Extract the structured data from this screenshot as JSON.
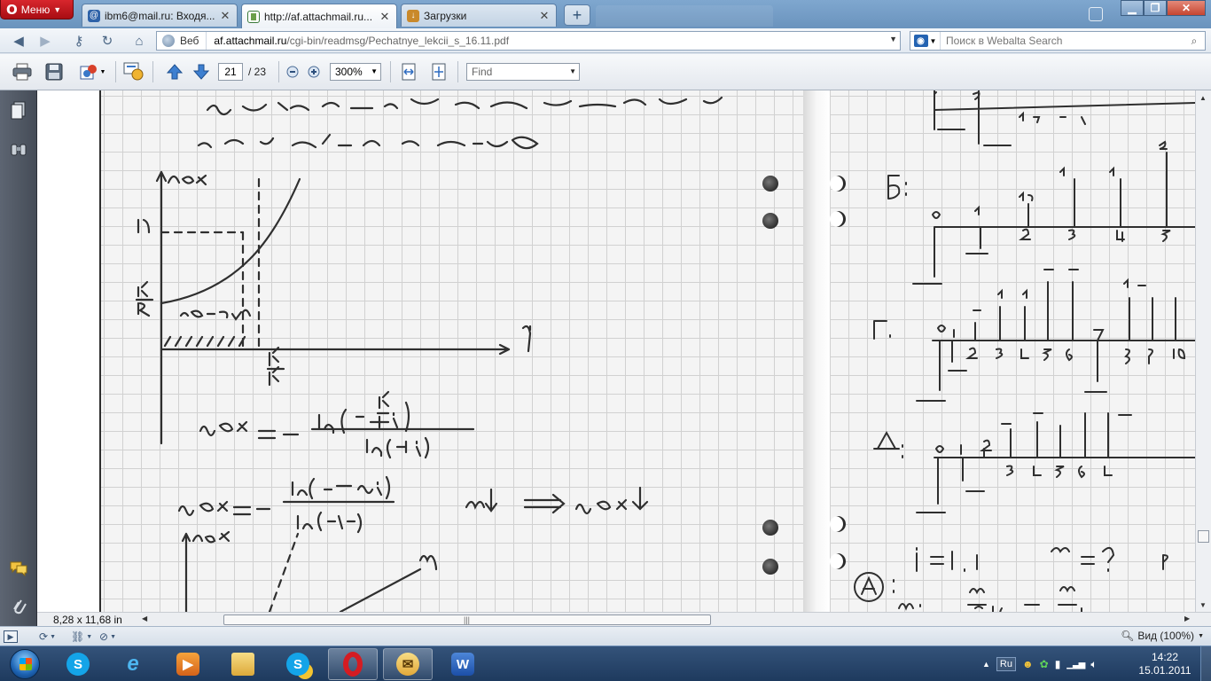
{
  "browser": {
    "menu_label": "Меню",
    "tabs": [
      {
        "title": "ibm6@mail.ru: Входя...",
        "active": false
      },
      {
        "title": "http://af.attachmail.ru...",
        "active": true
      },
      {
        "title": "Загрузки",
        "active": false
      }
    ],
    "new_tab_label": "+",
    "address": {
      "web_label": "Веб",
      "url_host": "af.attachmail.ru",
      "url_path": "/cgi-bin/readmsg/Pechatnye_lekcii_s_16.11.pdf"
    },
    "search": {
      "placeholder": "Поиск в Webalta Search"
    }
  },
  "pdf_toolbar": {
    "current_page": "21",
    "total_pages": "/ 23",
    "zoom": "300%",
    "find_placeholder": "Find"
  },
  "page_dims": "8,28 x 11,68 in",
  "status": {
    "zoom_label": "Вид (100%)"
  },
  "taskbar": {
    "lang": "Ru",
    "time": "14:22",
    "date": "15.01.2011"
  },
  "colors": {
    "tabbar": "#6a93bd",
    "opera_red": "#c4161c",
    "taskbar": "#1e3a5e",
    "sidepanel": "#454c57"
  }
}
